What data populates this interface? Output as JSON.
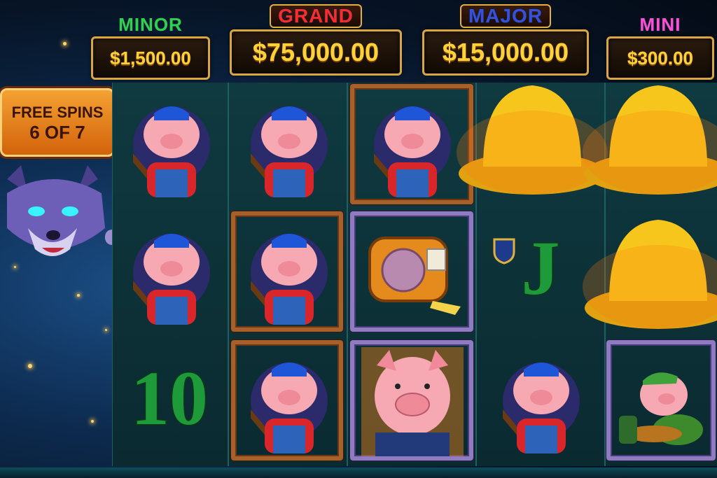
{
  "jackpots": {
    "minor": {
      "label": "MINOR",
      "value": "$1,500.00",
      "color": "#2fd24c"
    },
    "grand": {
      "label": "GRAND",
      "value": "$75,000.00",
      "color": "#ff2b2b"
    },
    "major": {
      "label": "MAJOR",
      "value": "$15,000.00",
      "color": "#3a4fd8"
    },
    "mini": {
      "label": "MINI",
      "value": "$300.00",
      "color": "#ff4fd3"
    }
  },
  "free_spins": {
    "line1": "FREE SPINS",
    "line2": "6 OF 7"
  },
  "reels": [
    [
      "pig-hardhat",
      "pig-hardhat",
      "ten"
    ],
    [
      "pig-hardhat",
      "pig-hardhat",
      "pig-hardhat"
    ],
    [
      "pig-hardhat",
      "tape-measure",
      "pig-suit"
    ],
    [
      "golden-hardhat",
      "jack",
      "pig-hardhat"
    ],
    [
      "golden-hardhat",
      "golden-hardhat",
      "pig-green-cap"
    ]
  ],
  "symbols": {
    "ten": "10",
    "jack": "J"
  },
  "colors": {
    "gold": "#ffd23a",
    "teal": "#0f3a40",
    "wood": "#a5602c"
  }
}
